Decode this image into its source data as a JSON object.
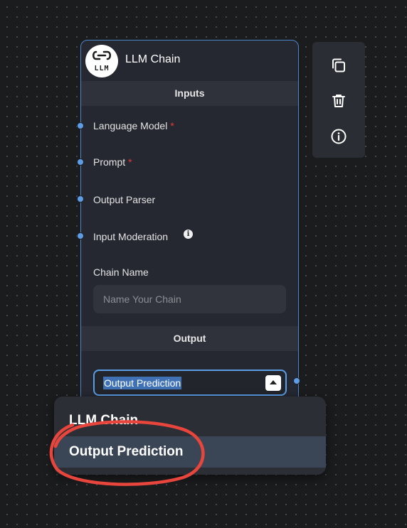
{
  "node": {
    "title": "LLM Chain",
    "logo_text": "LLM",
    "inputs_header": "Inputs",
    "inputs": [
      {
        "label": "Language Model",
        "required": "*"
      },
      {
        "label": "Prompt",
        "required": "*"
      },
      {
        "label": "Output Parser"
      },
      {
        "label": "Input Moderation",
        "info": "i"
      }
    ],
    "chain_name_label": "Chain Name",
    "chain_name_placeholder": "Name Your Chain",
    "output_header": "Output",
    "output_select_value": "Output Prediction"
  },
  "toolbar": {
    "icons": [
      "copy-icon",
      "trash-icon",
      "info-icon"
    ]
  },
  "dropdown": {
    "options": [
      "LLM Chain",
      "Output Prediction"
    ],
    "selected": "Output Prediction"
  },
  "colors": {
    "accent": "#5b9ee6",
    "node_bg": "#252831",
    "required": "#e53935",
    "annotation": "#e8453c"
  }
}
